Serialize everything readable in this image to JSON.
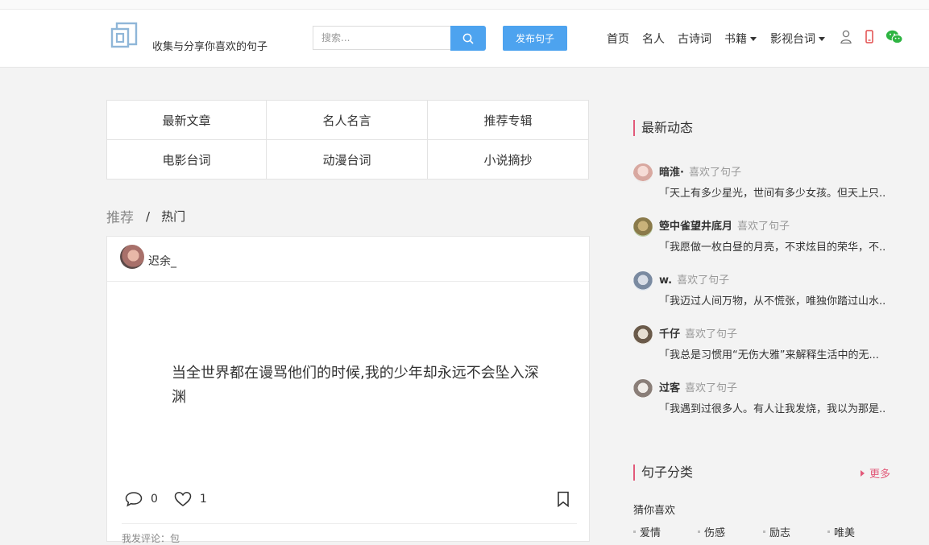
{
  "header": {
    "slogan": "收集与分享你喜欢的句子",
    "search_placeholder": "搜索...",
    "publish_label": "发布句子",
    "nav": [
      {
        "label": "首页"
      },
      {
        "label": "名人"
      },
      {
        "label": "古诗词"
      },
      {
        "label": "书籍"
      },
      {
        "label": "影视台词"
      }
    ]
  },
  "categories": [
    "最新文章",
    "名人名言",
    "推荐专辑",
    "电影台词",
    "动漫台词",
    "小说摘抄"
  ],
  "tabs": {
    "recommend": "推荐",
    "separator": "/",
    "hot": "热门"
  },
  "post": {
    "author": "迟余_",
    "text": "当全世界都在谩骂他们的时候,我的少年却永远不会坠入深渊",
    "comments": "0",
    "likes": "1",
    "comment_hint": "我发评论：包"
  },
  "sidebar": {
    "activity_title": "最新动态",
    "feed": [
      {
        "name": "暗淮·",
        "action": "喜欢了句子",
        "text": "「天上有多少星光，世间有多少女孩。但天上只..."
      },
      {
        "name": "箜中雀望井底月",
        "action": "喜欢了句子",
        "text": "「我愿做一枚白昼的月亮，不求炫目的荣华，不..."
      },
      {
        "name": "w.",
        "action": "喜欢了句子",
        "text": "「我迈过人间万物，从不慌张，唯独你踏过山水..."
      },
      {
        "name": "千仔",
        "action": "喜欢了句子",
        "text": "「我总是习惯用“无伤大雅”来解释生活中的无..."
      },
      {
        "name": "过客",
        "action": "喜欢了句子",
        "text": "「我遇到过很多人。有人让我发烧，我以为那是..."
      }
    ],
    "category_title": "句子分类",
    "more_label": "更多",
    "guess_title": "猜你喜欢",
    "tags": [
      "爱情",
      "伤感",
      "励志",
      "唯美"
    ]
  },
  "colors": {
    "accent": "#4da3ef",
    "section_marker": "#e25a7a",
    "background": "#f3f3f3"
  }
}
